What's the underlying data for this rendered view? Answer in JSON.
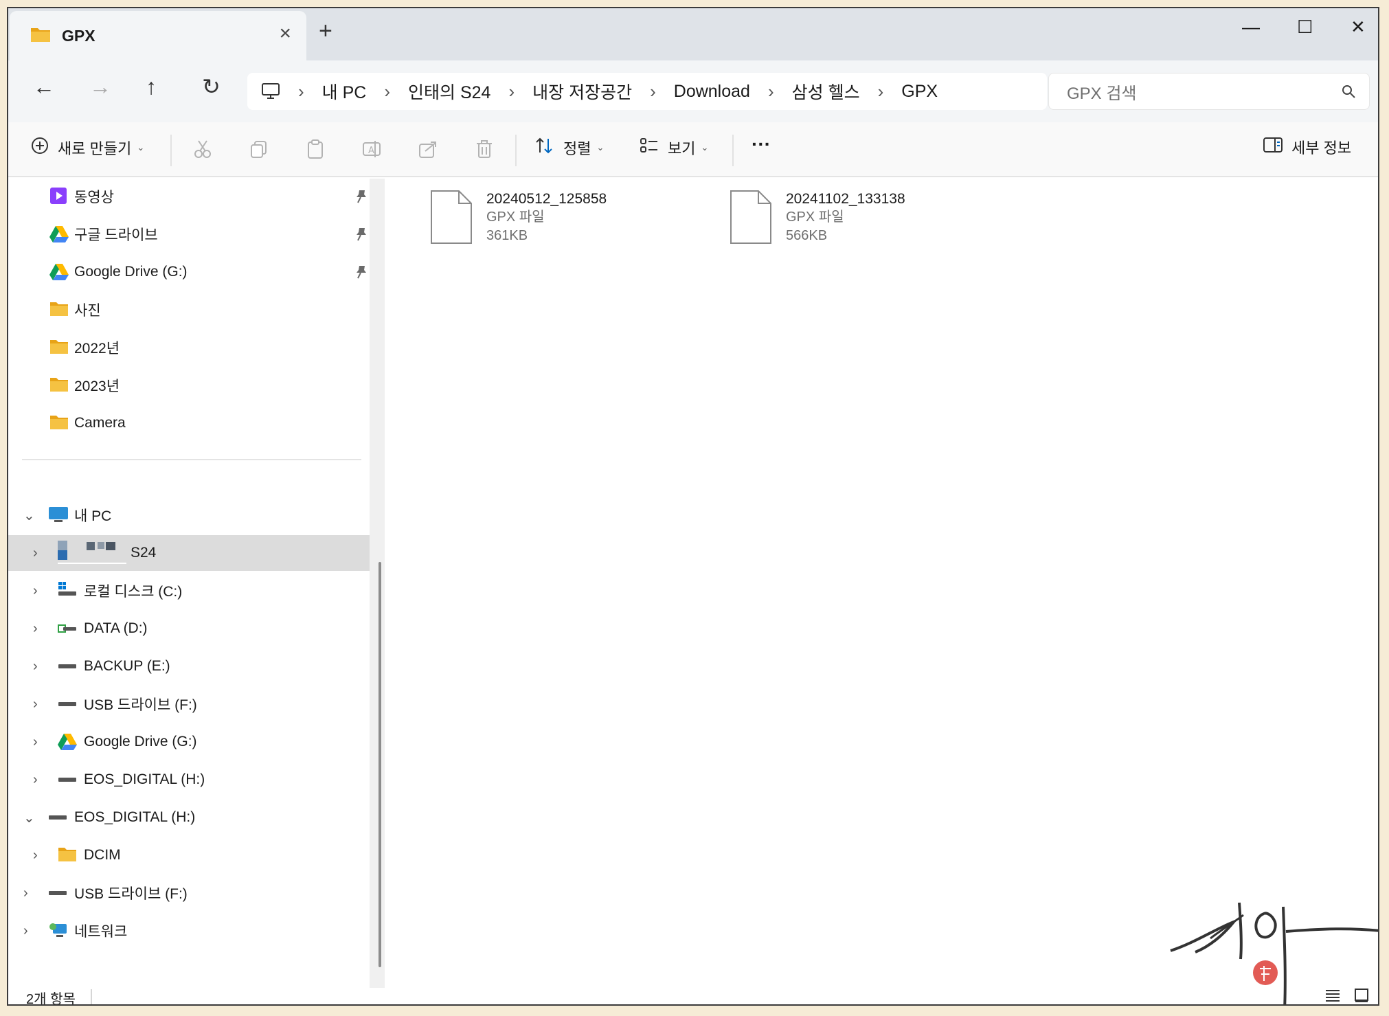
{
  "tab": {
    "title": "GPX",
    "close": "×",
    "new_tab": "+"
  },
  "window_controls": {
    "minimize": "—",
    "maximize": "☐",
    "close": "✕"
  },
  "nav": {
    "back": "←",
    "forward": "→",
    "up": "↑",
    "refresh": "↻"
  },
  "breadcrumb": [
    "내 PC",
    "인태의 S24",
    "내장 저장공간",
    "Download",
    "삼성 헬스",
    "GPX"
  ],
  "search": {
    "placeholder": "GPX 검색"
  },
  "toolbar": {
    "new_label": "새로 만들기",
    "sort_label": "정렬",
    "view_label": "보기",
    "more_label": "···",
    "details_label": "세부 정보"
  },
  "sidebar": {
    "pinned": [
      {
        "label": "동영상",
        "icon": "video-icon",
        "pinned": true
      },
      {
        "label": "구글 드라이브",
        "icon": "google-drive-icon",
        "pinned": true
      },
      {
        "label": "Google Drive (G:)",
        "icon": "google-drive-icon",
        "pinned": true
      },
      {
        "label": "사진",
        "icon": "folder-icon",
        "pinned": false
      },
      {
        "label": "2022년",
        "icon": "folder-icon",
        "pinned": false
      },
      {
        "label": "2023년",
        "icon": "folder-icon",
        "pinned": false
      },
      {
        "label": "Camera",
        "icon": "folder-icon",
        "pinned": false
      }
    ],
    "tree": [
      {
        "label": "내 PC",
        "icon": "monitor-icon",
        "expanded": true
      },
      {
        "label": "S24",
        "icon": "phone-icon",
        "selected": true
      },
      {
        "label": "로컬 디스크 (C:)",
        "icon": "windows-drive-icon"
      },
      {
        "label": "DATA (D:)",
        "icon": "drive-icon"
      },
      {
        "label": "BACKUP (E:)",
        "icon": "drive-icon"
      },
      {
        "label": "USB 드라이브 (F:)",
        "icon": "drive-icon"
      },
      {
        "label": "Google Drive (G:)",
        "icon": "google-drive-icon"
      },
      {
        "label": "EOS_DIGITAL (H:)",
        "icon": "drive-icon"
      },
      {
        "label": "EOS_DIGITAL (H:)",
        "icon": "drive-icon",
        "expanded": true
      },
      {
        "label": "DCIM",
        "icon": "folder-icon"
      },
      {
        "label": "USB 드라이브 (F:)",
        "icon": "drive-icon"
      },
      {
        "label": "네트워크",
        "icon": "network-icon"
      }
    ]
  },
  "files": [
    {
      "name": "20240512_125858",
      "type": "GPX 파일",
      "size": "361KB"
    },
    {
      "name": "20241102_133138",
      "type": "GPX 파일",
      "size": "566KB"
    }
  ],
  "status": {
    "count": "2개 항목"
  },
  "colors": {
    "folder": "#f5c242",
    "accent": "#0067c0",
    "selected": "#dcdcdc"
  }
}
